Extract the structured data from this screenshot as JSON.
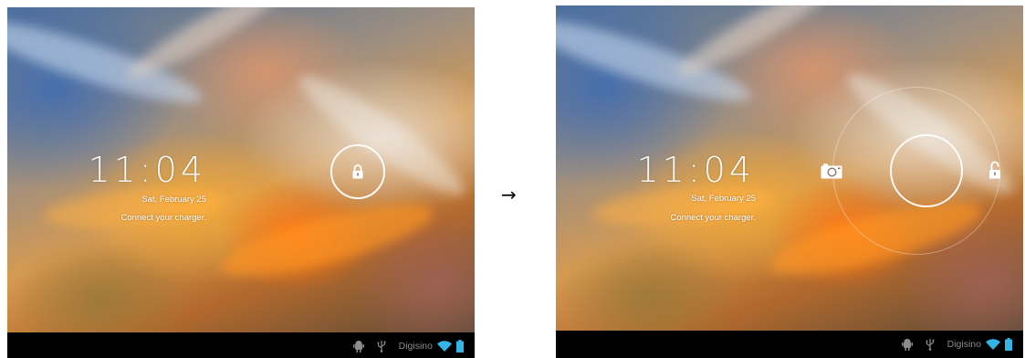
{
  "transition_arrow": "→",
  "screens": [
    {
      "state": "locked",
      "clock": "11:04",
      "date": "Sat, February 25",
      "status_message": "Connect your charger.",
      "icons": [
        "lock-icon"
      ],
      "statusbar": {
        "carrier": "Digisino",
        "icons": [
          "android-debug-icon",
          "usb-icon",
          "wifi-icon",
          "battery-icon"
        ]
      }
    },
    {
      "state": "unlock-ring-active",
      "clock": "11:04",
      "date": "Sat, February 25",
      "status_message": "Connect your charger.",
      "icons": [
        "camera-icon",
        "unlock-icon"
      ],
      "statusbar": {
        "carrier": "Digisino",
        "icons": [
          "android-debug-icon",
          "usb-icon",
          "wifi-icon",
          "battery-icon"
        ]
      }
    }
  ],
  "colors": {
    "status_text": "#8c8c8c",
    "wifi_accent": "#33b5e5",
    "ring": "#ffffff"
  }
}
